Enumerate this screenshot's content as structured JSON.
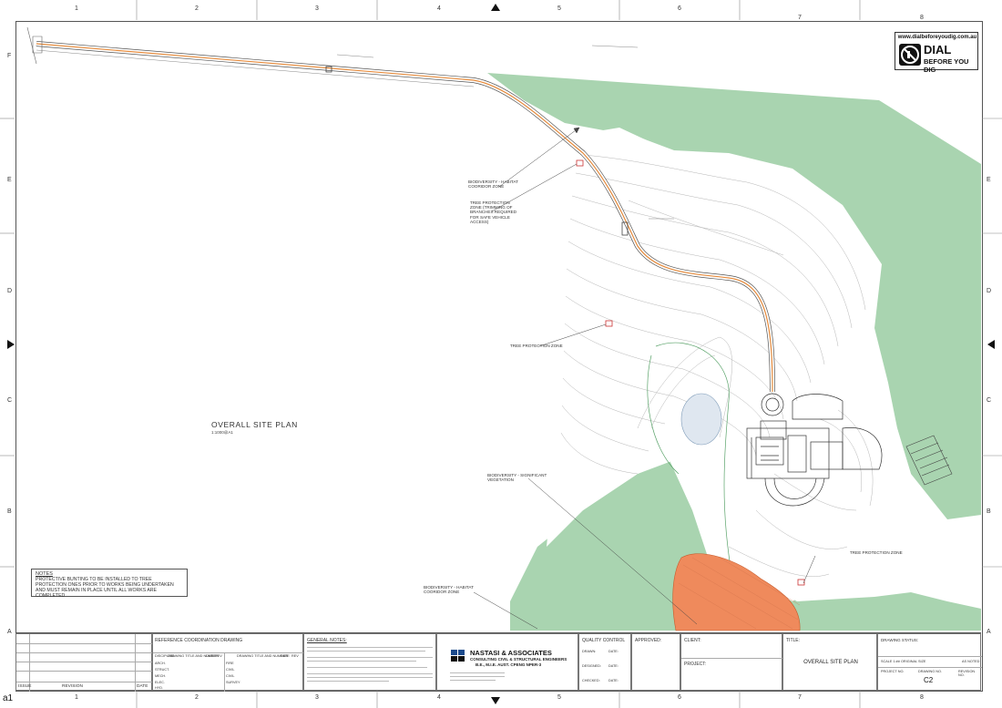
{
  "sheet": {
    "corner_mark": "a1",
    "column_numbers": [
      "1",
      "2",
      "3",
      "4",
      "5",
      "6",
      "7",
      "8"
    ],
    "row_letters": [
      "F",
      "E",
      "D",
      "C",
      "B",
      "A"
    ]
  },
  "plan": {
    "title": "OVERALL SITE PLAN",
    "scale": "1:1000@A1",
    "colors": {
      "vegetation": "#a9d4b0",
      "hazard": "#ef8a5c",
      "road": "#e58a3c",
      "contour": "#b5b5b5"
    }
  },
  "annotations": {
    "biodiversity_habitat_top": "BIODIVERSITY - HABITAT COORIDOR ZONE",
    "tree_protection_trimming": "TREE PROTECTION ZONE (TRIMMING OF BRANCHES REQUIRED FOR SAFE VEHICLE ACCESS)",
    "tree_protection_mid": "TREE PROTECTION ZONE",
    "biodiversity_vegetation": "BIODIVERSITY - SIGNIFICANT VEGETATION",
    "tree_protection_right": "TREE PROTECTION ZONE",
    "biodiversity_habitat_bottom": "BIODIVERSITY - HABITAT COORIDOR ZONE"
  },
  "notes": {
    "heading": "NOTES",
    "body": "PROTECTIVE BUNTING TO BE INSTALLED TO TREE PROTECTION ONES PRIOR TO WORKS BEING UNDERTAKEN AND MUST REMAIN IN PLACE UNTIL ALL WORKS ARE COMPLETED"
  },
  "logo": {
    "url": "www.dialbeforeyoudig.com.au",
    "line1": "DIAL",
    "line2": "BEFORE YOU DIG"
  },
  "title_block": {
    "issue_label": "ISSUE",
    "revision_label": "REVISION",
    "date_label": "DATE",
    "reference_heading": "REFERENCE COORDINATION DRAWING",
    "ref_col1": "DISCIPLINE",
    "ref_col2": "DRAWING TITLE AND NUMBER",
    "ref_col3": "DATE",
    "ref_col4": "REV",
    "disciplines_left": [
      "ARCH.",
      "STRUCT.",
      "MECH.",
      "ELEC.",
      "HYD."
    ],
    "disciplines_right": [
      "FIRE",
      "CIVIL",
      "CIVIL",
      "SURVEY"
    ],
    "general_notes_heading": "GENERAL NOTES:",
    "company_name": "NASTASI & ASSOCIATES",
    "company_sub1": "CONSULTING CIVIL & STRUCTURAL ENGINEERS",
    "company_sub2": "B.E., M.I.E. AUST. CPENG NPER-3",
    "quality_control": "QUALITY CONTROL",
    "approved": "APPROVED:",
    "drawn": "DRAWN:",
    "designed": "DESIGNED:",
    "checked": "CHECKED:",
    "date": "DATE:",
    "client": "CLIENT:",
    "project": "PROJECT:",
    "title_label": "TITLE:",
    "sheet_title": "OVERALL SITE PLAN",
    "drawing_status": "DRAWING STATUS:",
    "scale_label": "SCALE 1:## ORIGINAL SIZE",
    "scale_value": "AS NOTED",
    "project_no": "PROJECT NO.",
    "drawing_no_label": "DRAWING NO.",
    "revision_no": "REVISION NO.",
    "drawing_no": "C2"
  }
}
